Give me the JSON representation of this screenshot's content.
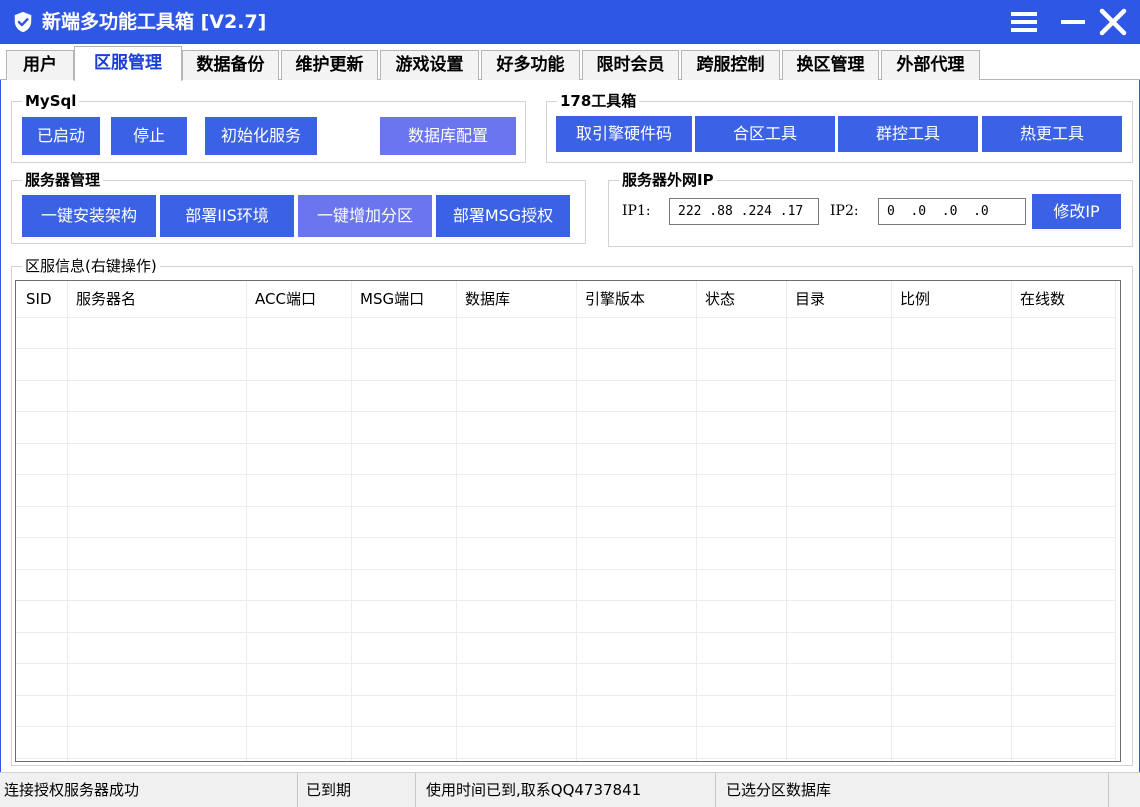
{
  "window": {
    "title": "新端多功能工具箱 [V2.7]",
    "icons": {
      "app": "shield-check-icon",
      "menu": "hamburger-icon",
      "minimize": "minimize-icon",
      "close": "close-icon"
    },
    "colors": {
      "titlebar": "#2f57e6",
      "button": "#3b62e4",
      "button_alt": "#6b76ee",
      "active_tab_text": "#1a3ed8"
    }
  },
  "tabs": [
    {
      "label": "用户"
    },
    {
      "label": "区服管理",
      "active": true
    },
    {
      "label": "数据备份"
    },
    {
      "label": "维护更新"
    },
    {
      "label": "游戏设置"
    },
    {
      "label": "好多功能"
    },
    {
      "label": "限时会员"
    },
    {
      "label": "跨服控制"
    },
    {
      "label": "换区管理"
    },
    {
      "label": "外部代理"
    }
  ],
  "mysql": {
    "title": "MySql",
    "buttons": [
      "已启动",
      "停止",
      "初始化服务",
      "数据库配置"
    ]
  },
  "tools178": {
    "title": "178工具箱",
    "buttons": [
      "取引擎硬件码",
      "合区工具",
      "群控工具",
      "热更工具"
    ]
  },
  "server_mgmt": {
    "title": "服务器管理",
    "buttons": [
      "一键安装架构",
      "部署IIS环境",
      "一键增加分区",
      "部署MSG授权"
    ]
  },
  "external_ip": {
    "title": "服务器外网IP",
    "ip1_label": "IP1:",
    "ip1_value": "222 .88 .224 .17",
    "ip2_label": "IP2:",
    "ip2_value": "0  .0  .0  .0",
    "modify_button": "修改IP"
  },
  "zone_info": {
    "title": "区服信息(右键操作)",
    "columns": [
      "SID",
      "服务器名",
      "ACC端口",
      "MSG端口",
      "数据库",
      "引擎版本",
      "状态",
      "目录",
      "比例",
      "在线数"
    ],
    "rows": []
  },
  "status_bar": [
    "连接授权服务器成功",
    "已到期",
    "使用时间已到,取系QQ4737841",
    "已选分区数据库",
    ""
  ]
}
